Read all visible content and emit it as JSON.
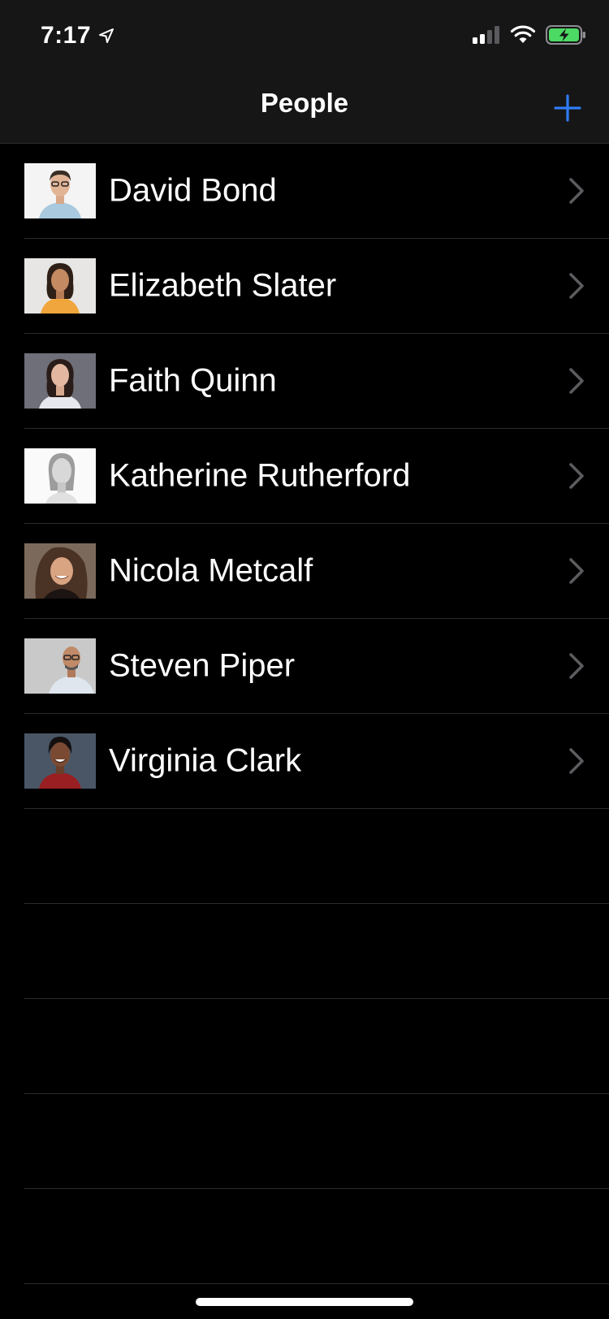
{
  "status_bar": {
    "time": "7:17",
    "battery_color": "#4cd964"
  },
  "nav": {
    "title": "People",
    "add_icon": "plus-icon",
    "accent_color": "#2f7cf6"
  },
  "people": [
    {
      "name": "David Bond",
      "avatar": "photo"
    },
    {
      "name": "Elizabeth Slater",
      "avatar": "photo"
    },
    {
      "name": "Faith Quinn",
      "avatar": "photo"
    },
    {
      "name": "Katherine Rutherford",
      "avatar": "photo"
    },
    {
      "name": "Nicola Metcalf",
      "avatar": "photo"
    },
    {
      "name": "Steven Piper",
      "avatar": "photo"
    },
    {
      "name": "Virginia Clark",
      "avatar": "photo"
    }
  ]
}
